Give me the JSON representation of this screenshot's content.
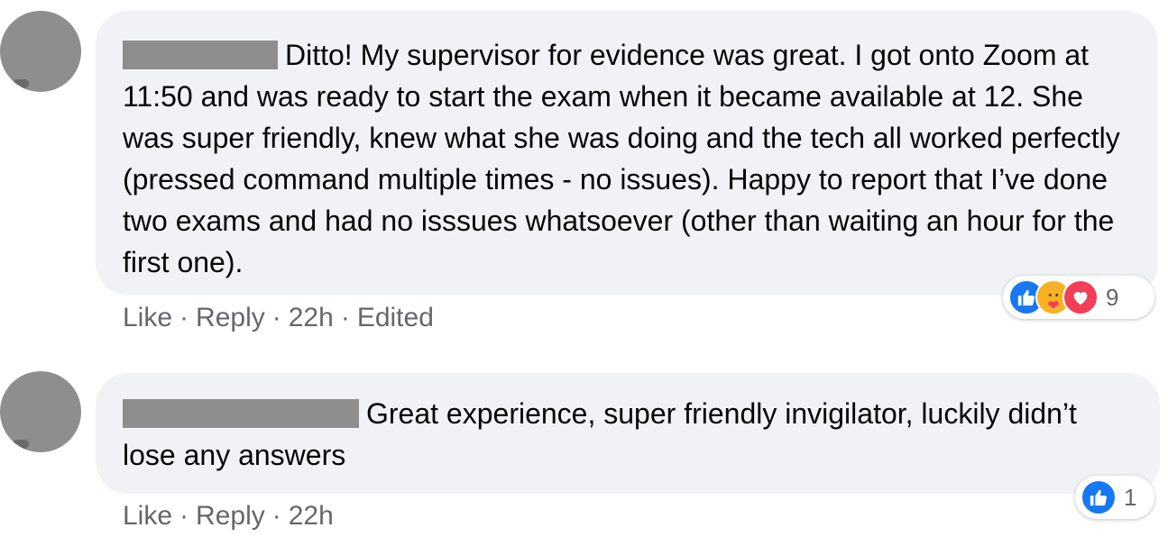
{
  "comments": [
    {
      "text": "Ditto! My supervisor for evidence was great. I got onto Zoom at 11:50 and was ready to start the exam when it became available at 12. She was super friendly, knew what she was doing and the tech all worked perfectly (pressed command multiple times - no issues). Happy to report that I’ve done two exams and had no isssues whatsoever (other than waiting an hour for the first one).",
      "actions": {
        "like": "Like",
        "reply": "Reply",
        "time": "22h",
        "edited": "Edited"
      },
      "reactions": {
        "icons": [
          "like-icon",
          "care-icon",
          "love-icon"
        ],
        "count": "9"
      }
    },
    {
      "text": "Great experience, super friendly invigilator, luckily didn’t lose any answers",
      "actions": {
        "like": "Like",
        "reply": "Reply",
        "time": "22h"
      },
      "reactions": {
        "icons": [
          "like-icon"
        ],
        "count": "1"
      }
    }
  ],
  "separator": "·",
  "colors": {
    "like": "#1877f2",
    "love": "#f33e58",
    "care": "#f7b125",
    "bubble": "#f0f2f5",
    "meta": "#65676b"
  }
}
